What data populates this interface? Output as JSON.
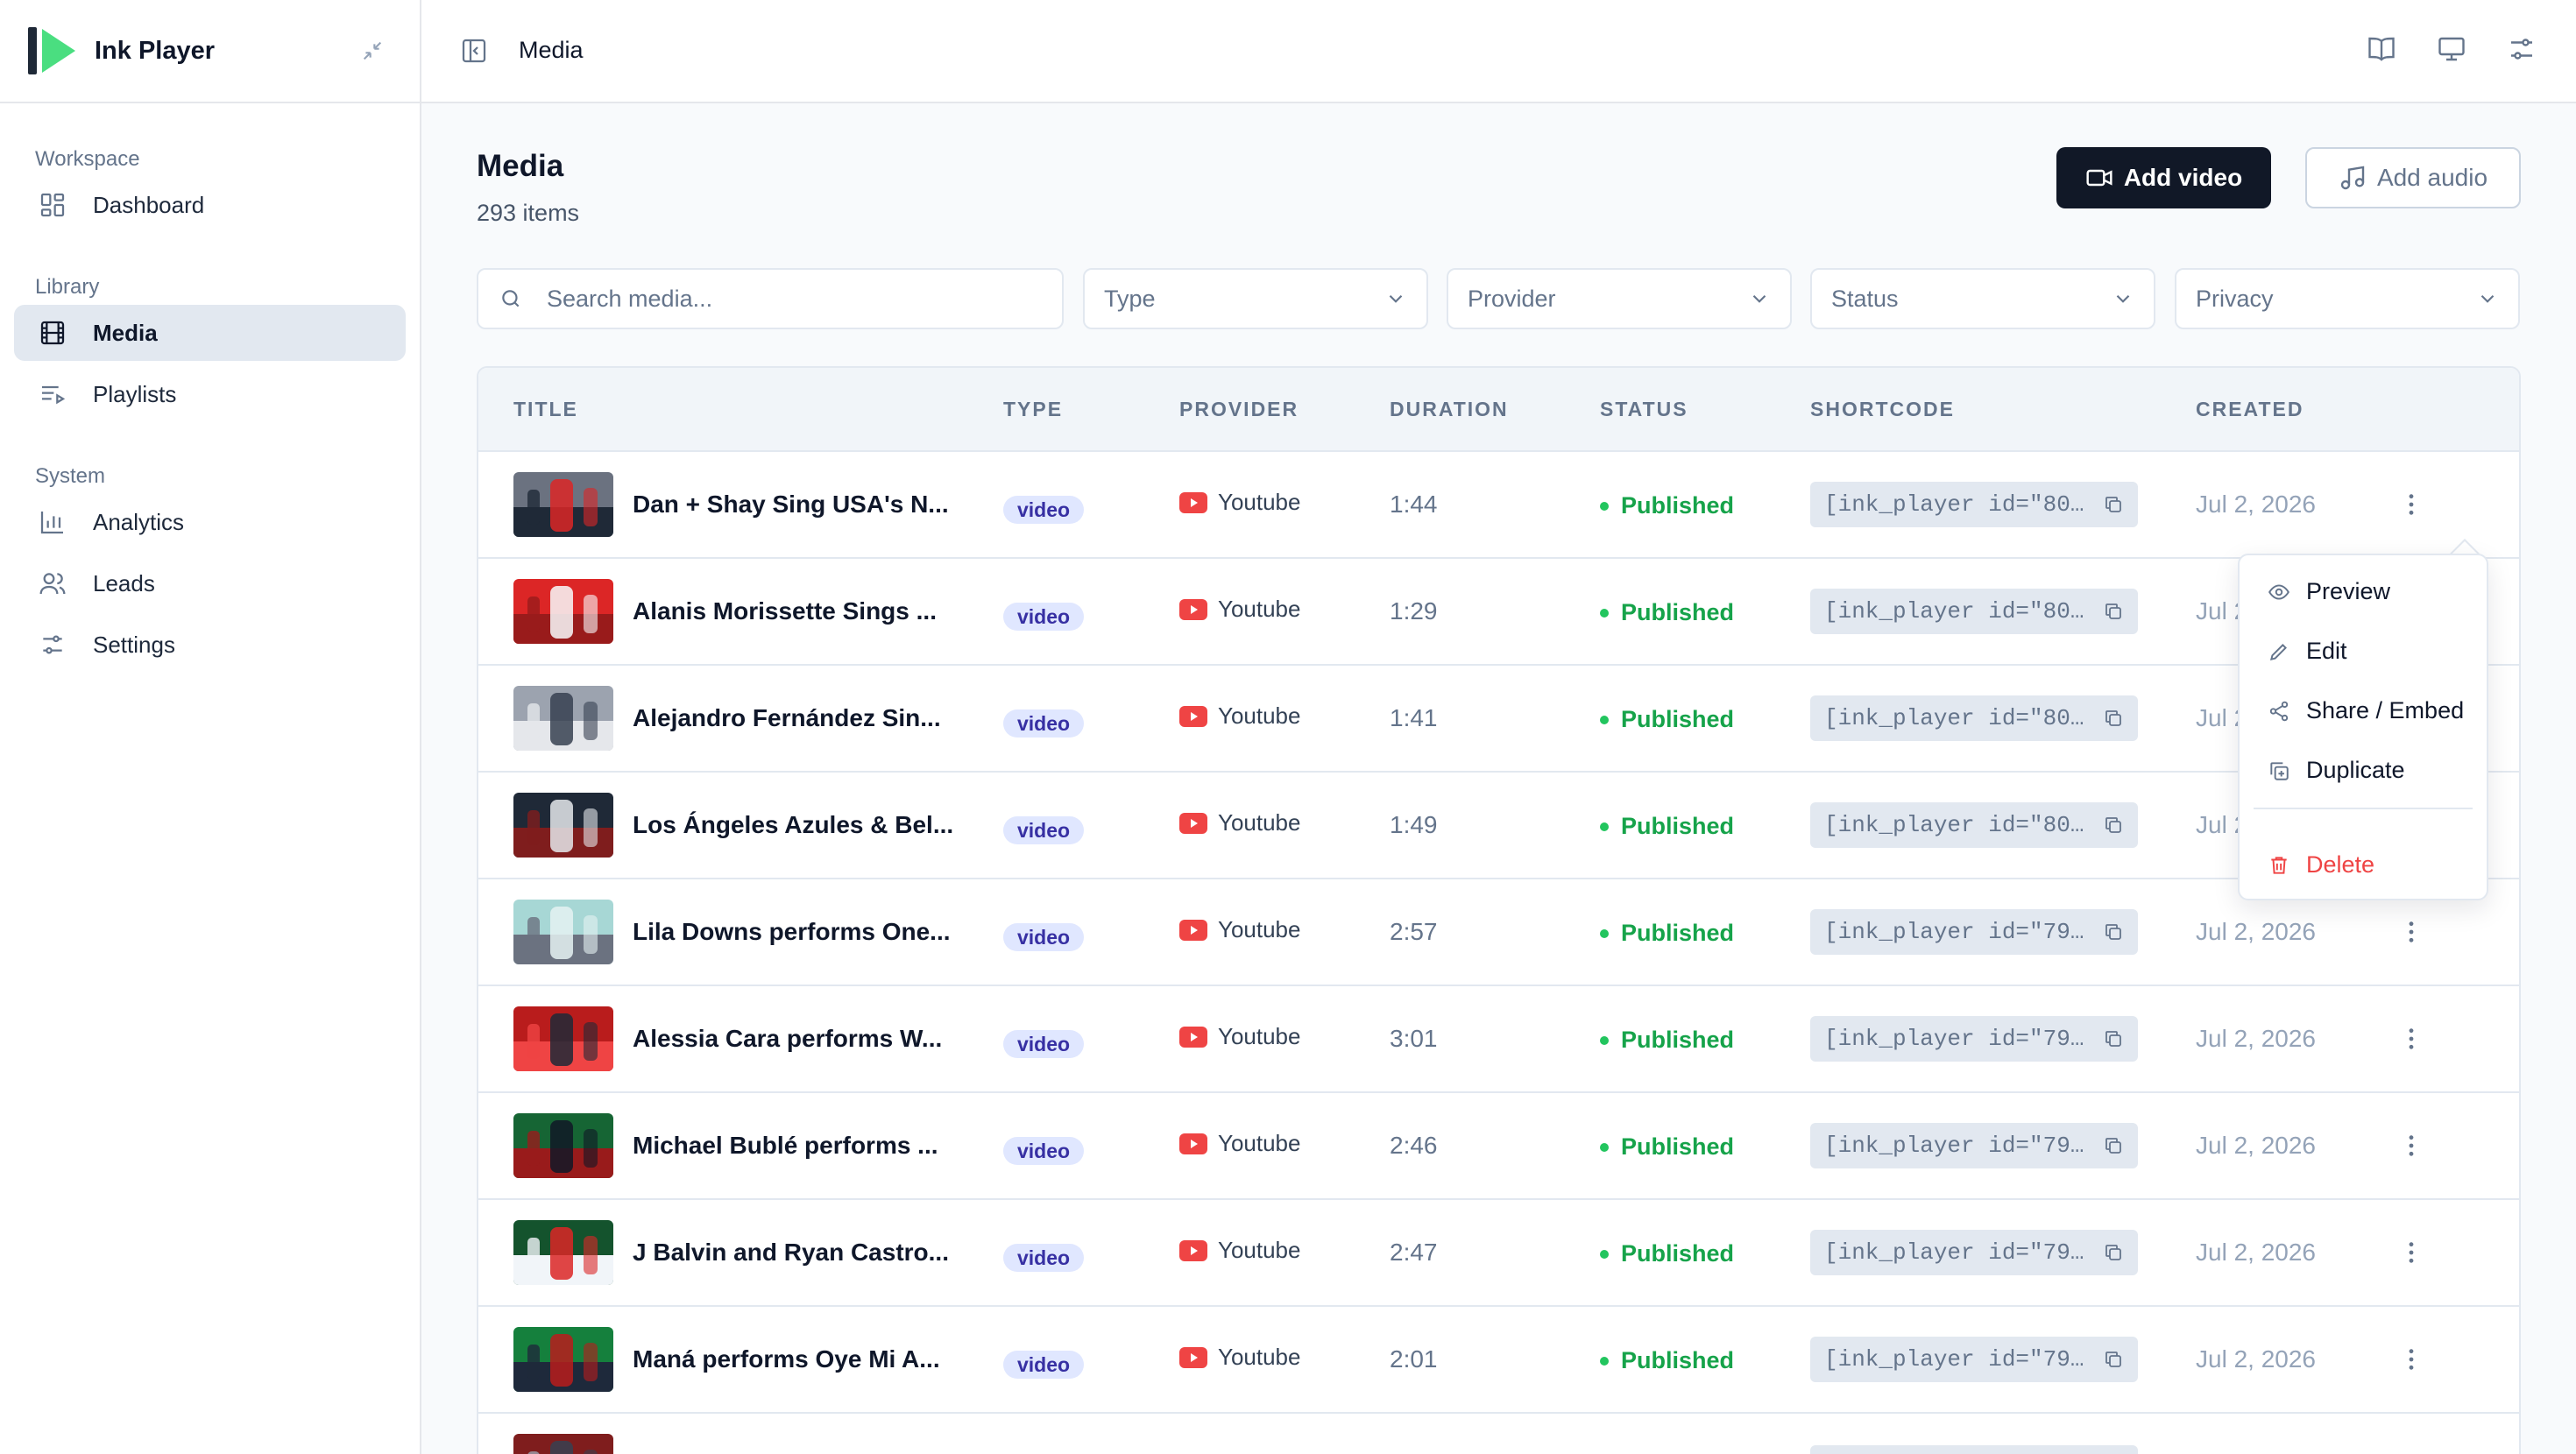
{
  "app": {
    "name": "Ink Player"
  },
  "breadcrumb": {
    "current": "Media"
  },
  "sidebar": {
    "sections": [
      {
        "heading": "Workspace",
        "items": [
          {
            "label": "Dashboard",
            "icon": "dashboard-icon",
            "active": false
          }
        ]
      },
      {
        "heading": "Library",
        "items": [
          {
            "label": "Media",
            "icon": "film-icon",
            "active": true
          },
          {
            "label": "Playlists",
            "icon": "playlist-icon",
            "active": false
          }
        ]
      },
      {
        "heading": "System",
        "items": [
          {
            "label": "Analytics",
            "icon": "bar-chart-icon",
            "active": false
          },
          {
            "label": "Leads",
            "icon": "users-icon",
            "active": false
          },
          {
            "label": "Settings",
            "icon": "sliders-icon",
            "active": false
          }
        ]
      }
    ]
  },
  "page": {
    "title": "Media",
    "subtitle": "293 items",
    "add_video_label": "Add video",
    "add_audio_label": "Add audio"
  },
  "filters": {
    "search_placeholder": "Search media...",
    "type": "Type",
    "provider": "Provider",
    "status": "Status",
    "privacy": "Privacy"
  },
  "table": {
    "columns": [
      "TITLE",
      "TYPE",
      "PROVIDER",
      "DURATION",
      "STATUS",
      "SHORTCODE",
      "CREATED"
    ],
    "rows": [
      {
        "title": "Dan + Shay Sing USA's N...",
        "type": "video",
        "provider": "Youtube",
        "duration": "1:44",
        "status": "Published",
        "shortcode": "[ink_player id=\"80…",
        "created": "Jul 2, 2026",
        "thumb": [
          "#6b7280",
          "#dc2626",
          "#1f2937"
        ]
      },
      {
        "title": "Alanis Morissette Sings ...",
        "type": "video",
        "provider": "Youtube",
        "duration": "1:29",
        "status": "Published",
        "shortcode": "[ink_player id=\"80…",
        "created": "Jul 2, 2026",
        "thumb": [
          "#dc2626",
          "#f8fafc",
          "#991b1b"
        ]
      },
      {
        "title": "Alejandro Fernández Sin...",
        "type": "video",
        "provider": "Youtube",
        "duration": "1:41",
        "status": "Published",
        "shortcode": "[ink_player id=\"80…",
        "created": "Jul 2, 2026",
        "thumb": [
          "#9ca3af",
          "#374151",
          "#e5e7eb"
        ]
      },
      {
        "title": "Los Ángeles Azules & Bel...",
        "type": "video",
        "provider": "Youtube",
        "duration": "1:49",
        "status": "Published",
        "shortcode": "[ink_player id=\"80…",
        "created": "Jul 2, 2026",
        "thumb": [
          "#1f2937",
          "#e5e7eb",
          "#7f1d1d"
        ]
      },
      {
        "title": "Lila Downs performs One...",
        "type": "video",
        "provider": "Youtube",
        "duration": "2:57",
        "status": "Published",
        "shortcode": "[ink_player id=\"79…",
        "created": "Jul 2, 2026",
        "thumb": [
          "#a7d7d5",
          "#e5f2f2",
          "#6b7280"
        ]
      },
      {
        "title": "Alessia Cara performs W...",
        "type": "video",
        "provider": "Youtube",
        "duration": "3:01",
        "status": "Published",
        "shortcode": "[ink_player id=\"79…",
        "created": "Jul 2, 2026",
        "thumb": [
          "#b91c1c",
          "#1f2937",
          "#ef4444"
        ]
      },
      {
        "title": "Michael Bublé performs ...",
        "type": "video",
        "provider": "Youtube",
        "duration": "2:46",
        "status": "Published",
        "shortcode": "[ink_player id=\"79…",
        "created": "Jul 2, 2026",
        "thumb": [
          "#166534",
          "#111827",
          "#991b1b"
        ]
      },
      {
        "title": "J Balvin and Ryan Castro...",
        "type": "video",
        "provider": "Youtube",
        "duration": "2:47",
        "status": "Published",
        "shortcode": "[ink_player id=\"79…",
        "created": "Jul 2, 2026",
        "thumb": [
          "#14532d",
          "#dc2626",
          "#f1f5f9"
        ]
      },
      {
        "title": "Maná performs Oye Mi A...",
        "type": "video",
        "provider": "Youtube",
        "duration": "2:01",
        "status": "Published",
        "shortcode": "[ink_player id=\"79…",
        "created": "Jul 2, 2026",
        "thumb": [
          "#15803d",
          "#b91c1c",
          "#1e293b"
        ]
      },
      {
        "title": "",
        "type": "",
        "provider": "",
        "duration": "",
        "status": "",
        "shortcode": "",
        "created": "",
        "thumb": [
          "#7f1d1d",
          "#374151",
          "#9ca3af"
        ]
      }
    ]
  },
  "row_menu": {
    "items": [
      {
        "label": "Preview",
        "icon": "eye-icon"
      },
      {
        "label": "Edit",
        "icon": "pencil-icon"
      },
      {
        "label": "Share / Embed",
        "icon": "share-icon"
      },
      {
        "label": "Duplicate",
        "icon": "duplicate-icon"
      }
    ],
    "danger_item": {
      "label": "Delete",
      "icon": "trash-icon"
    }
  },
  "colors": {
    "primary": "#111827",
    "published": "#16a34a",
    "danger": "#ef4444",
    "badge_bg": "#e0e7ff",
    "youtube": "#ef4444",
    "brand_dark": "#1f2937",
    "brand_green": "#4ade80"
  }
}
